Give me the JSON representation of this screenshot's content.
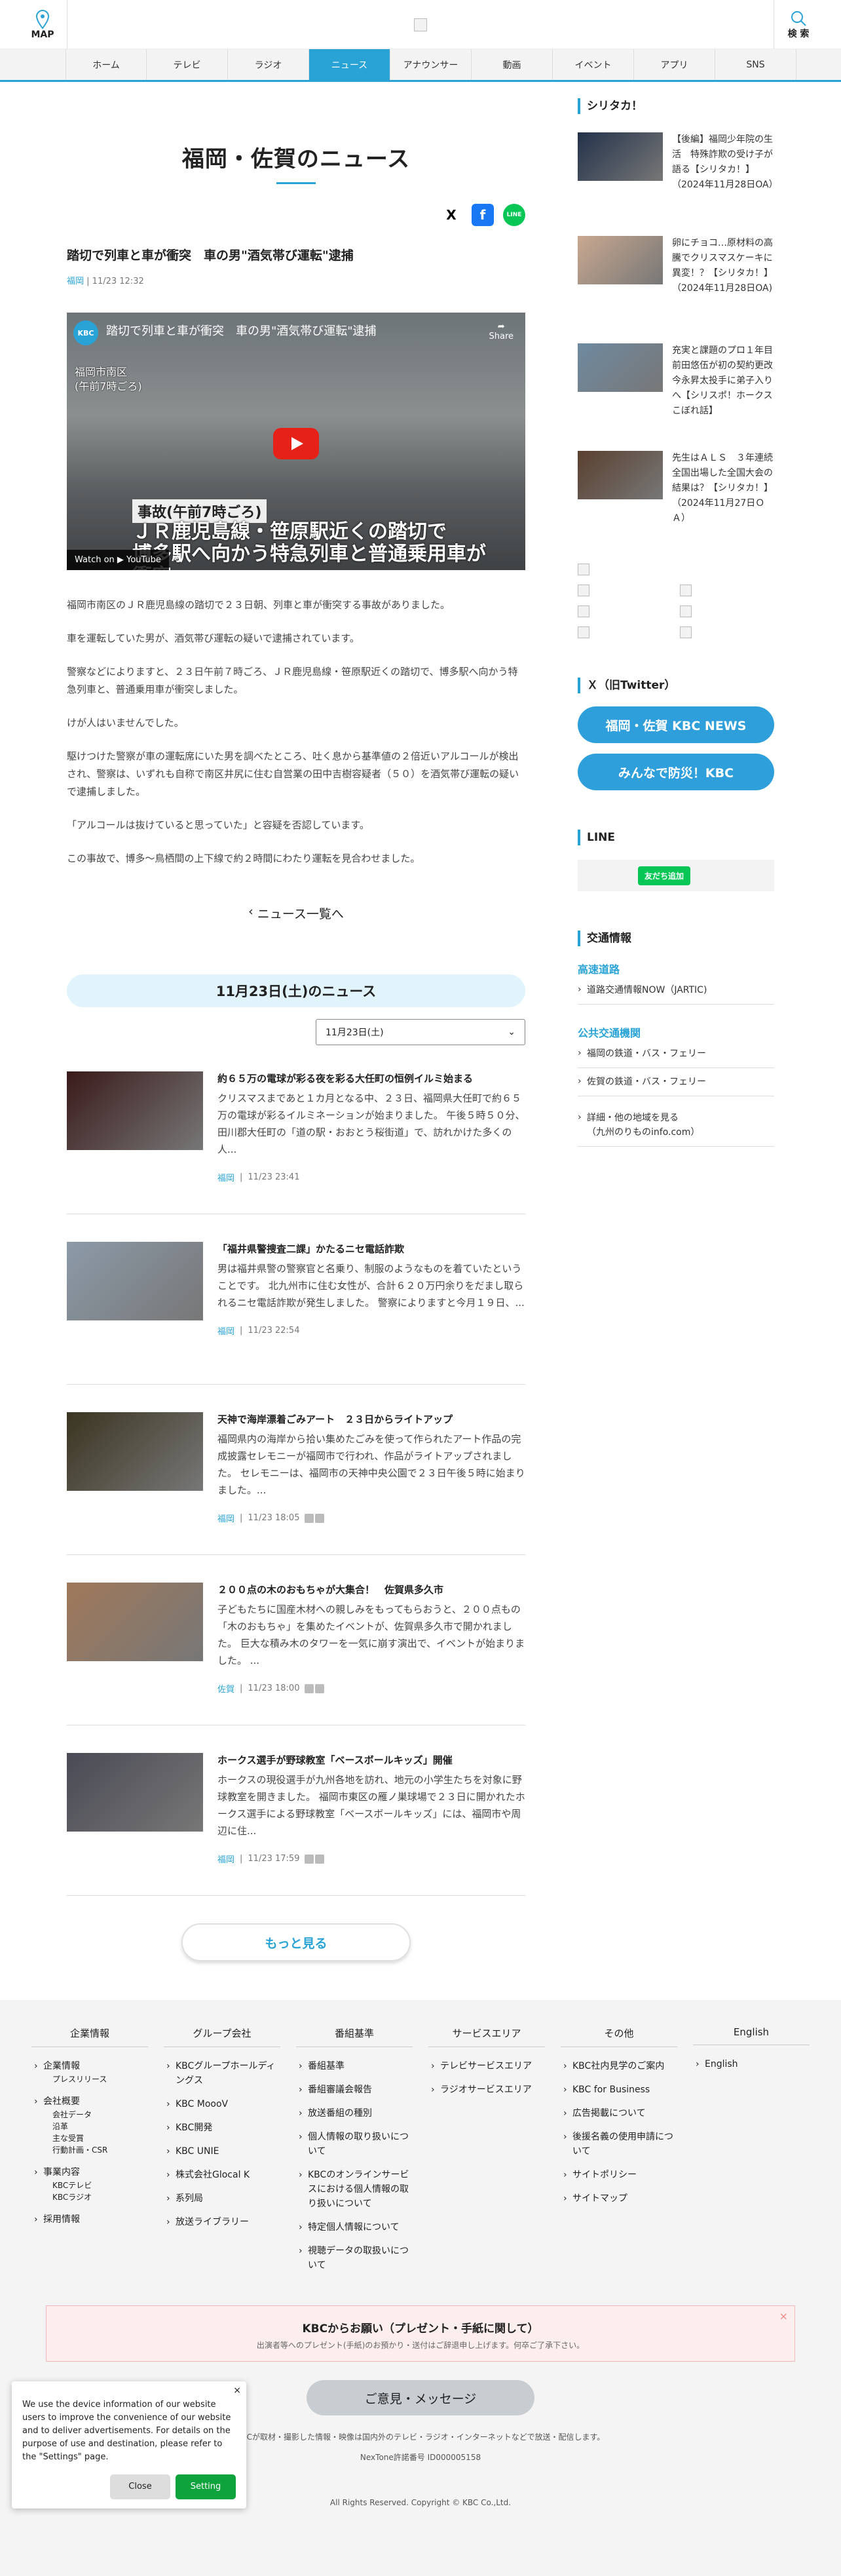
{
  "header": {
    "map_label": "MAP",
    "search_label": "検 索"
  },
  "nav": [
    "ホーム",
    "テレビ",
    "ラジオ",
    "ニュース",
    "アナウンサー",
    "動画",
    "イベント",
    "アプリ",
    "SNS"
  ],
  "section_title": "福岡・佐賀のニュース",
  "share": {
    "x": "X",
    "facebook": "f",
    "line": "LINE"
  },
  "article": {
    "title": "踏切で列車と車が衝突　車の男\"酒気帯び運転\"逮捕",
    "category": "福岡",
    "datetime": "11/23 12:32",
    "video": {
      "channel": "KBC",
      "title": "踏切で列車と車が衝突　車の男\"酒気帯び運転\"逮捕",
      "share": "Share",
      "side_caption": "福岡市南区\n(午前7時ごろ)",
      "caption1": "事故(午前7時ごろ)",
      "caption2": "ＪＲ鹿児島線・笹原駅近くの踏切で\n博多駅へ向かう特急列車と普通乗用車が衝突",
      "watch_on": "Watch on ▶ YouTube"
    },
    "paragraphs": [
      "福岡市南区のＪＲ鹿児島線の踏切で２３日朝、列車と車が衝突する事故がありました。",
      "車を運転していた男が、酒気帯び運転の疑いで逮捕されています。",
      "警察などによりますと、２３日午前７時ごろ、ＪＲ鹿児島線・笹原駅近くの踏切で、博多駅へ向かう特急列車と、普通乗用車が衝突しました。",
      "けが人はいませんでした。",
      "駆けつけた警察が車の運転席にいた男を調べたところ、吐く息から基準値の２倍近いアルコールが検出され、警察は、いずれも自称で南区井尻に住む自営業の田中吉樹容疑者（５０）を酒気帯び運転の疑いで逮捕しました。",
      "「アルコールは抜けていると思っていた」と容疑を否認しています。",
      "この事故で、博多～鳥栖間の上下線で約２時間にわたり運転を見合わせました。"
    ]
  },
  "back_link": "ニュース一覧へ",
  "date_band": "11月23日(土)のニュース",
  "date_select": "11月23日(土)",
  "news_list": [
    {
      "title": "約６５万の電球が彩る夜を彩る大任町の恒例イルミ始まる",
      "desc": "クリスマスまであと１カ月となる中、２３日、福岡県大任町で約６５万の電球が彩るイルミネーションが始まりました。 午後５時５０分、田川郡大任町の「道の駅・おおとう桜街道」で、訪れかけた多くの人...",
      "category": "福岡",
      "datetime": "11/23 23:41",
      "badge": false,
      "thumb": "#3a1a1a"
    },
    {
      "title": "「福井県警捜査二課」かたるニセ電話詐欺",
      "desc": "男は福井県警の警察官と名乗り、制服のようなものを着ていたということです。 北九州市に住む女性が、合計６２０万円余りをだまし取られるニセ電話詐欺が発生しました。 警察によりますと今月１９日、...",
      "category": "福岡",
      "datetime": "11/23 22:54",
      "badge": false,
      "thumb": "#8c9aa8"
    },
    {
      "title": "天神で海岸漂着ごみアート　２３日からライトアップ",
      "desc": "福岡県内の海岸から拾い集めたごみを使って作られたアート作品の完成披露セレモニーが福岡市で行われ、作品がライトアップされました。 セレモニーは、福岡市の天神中央公園で２３日午後５時に始まりました。...",
      "category": "福岡",
      "datetime": "11/23 18:05",
      "badge": true,
      "thumb": "#3a3420"
    },
    {
      "title": "２００点の木のおもちゃが大集合！　佐賀県多久市",
      "desc": "子どもたちに国産木材への親しみをもってもらおうと、２００点もの「木のおもちゃ」を集めたイベントが、佐賀県多久市で開かれました。 巨大な積み木のタワーを一気に崩す演出で、イベントが始まりました。 ...",
      "category": "佐賀",
      "datetime": "11/23 18:00",
      "badge": true,
      "thumb": "#a0785a"
    },
    {
      "title": "ホークス選手が野球教室「ベースボールキッズ」開催",
      "desc": "ホークスの現役選手が九州各地を訪れ、地元の小学生たちを対象に野球教室を開きました。 福岡市東区の雁ノ巣球場で２３日に開かれたホークス選手による野球教室「ベースボールキッズ」には、福岡市や周辺に住...",
      "category": "福岡",
      "datetime": "11/23 17:59",
      "badge": true,
      "thumb": "#4a4a55"
    }
  ],
  "more_button": "もっと見る",
  "sidebar": {
    "shiritaka_title": "シリタカ！",
    "shiritaka": [
      {
        "text": "【後編】福岡少年院の生活　特殊詐欺の受け子が語る【シリタカ！】（2024年11月28日OA）",
        "thumb": "#23324a"
      },
      {
        "text": "卵にチョコ…原材料の高騰でクリスマスケーキに異変！？【シリタカ！】（2024年11月28日OA)",
        "thumb": "#c9a890"
      },
      {
        "text": "充実と課題のプロ１年目 前田悠伍が初の契約更改 今永昇太投手に弟子入りへ【シリスポ！ホークスこぼれ話】",
        "thumb": "#6f8aa0"
      },
      {
        "text": "先生はＡＬＳ　３年連続全国出場した全国大会の結果は？【シリタカ！】（2024年11月27日ＯＡ）",
        "thumb": "#5a4030"
      }
    ],
    "x_title": "Ｘ（旧Twitter）",
    "x_buttons": [
      "福岡・佐賀 KBC NEWS",
      "みんなで防災！KBC"
    ],
    "line_title": "LINE",
    "line_button": "友だち追加",
    "traffic_title": "交通情報",
    "road_label": "高速道路",
    "road_links": [
      "道路交通情報NOW（JARTIC)"
    ],
    "public_label": "公共交通機関",
    "public_links": [
      "福岡の鉄道・バス・フェリー",
      "佐賀の鉄道・バス・フェリー",
      "詳細・他の地域を見る\n（九州のりものinfo.com）"
    ]
  },
  "footer": {
    "columns": [
      {
        "title": "企業情報",
        "items": [
          {
            "label": "企業情報",
            "subs": [
              "プレスリリース"
            ]
          },
          {
            "label": "会社概要",
            "subs": [
              "会社データ",
              "沿革",
              "主な受賞",
              "行動計画・CSR"
            ]
          },
          {
            "label": "事業内容",
            "subs": [
              "KBCテレビ",
              "KBCラジオ"
            ]
          },
          {
            "label": "採用情報",
            "subs": []
          }
        ]
      },
      {
        "title": "グループ会社",
        "items": [
          {
            "label": "KBCグループホールディングス",
            "subs": []
          },
          {
            "label": "KBC MoooV",
            "subs": []
          },
          {
            "label": "KBC開発",
            "subs": []
          },
          {
            "label": "KBC UNIE",
            "subs": []
          },
          {
            "label": "株式会社Glocal K",
            "subs": []
          },
          {
            "label": "系列局",
            "subs": []
          },
          {
            "label": "放送ライブラリー",
            "subs": []
          }
        ]
      },
      {
        "title": "番組基準",
        "items": [
          {
            "label": "番組基準",
            "subs": []
          },
          {
            "label": "番組審議会報告",
            "subs": []
          },
          {
            "label": "放送番組の種別",
            "subs": []
          },
          {
            "label": "個人情報の取り扱いについて",
            "subs": []
          },
          {
            "label": "KBCのオンラインサービスにおける個人情報の取り扱いについて",
            "subs": []
          },
          {
            "label": "特定個人情報について",
            "subs": []
          },
          {
            "label": "視聴データの取扱いについて",
            "subs": []
          }
        ]
      },
      {
        "title": "サービスエリア",
        "items": [
          {
            "label": "テレビサービスエリア",
            "subs": []
          },
          {
            "label": "ラジオサービスエリア",
            "subs": []
          }
        ]
      },
      {
        "title": "その他",
        "items": [
          {
            "label": "KBC社内見学のご案内",
            "subs": []
          },
          {
            "label": "KBC for Business",
            "subs": []
          },
          {
            "label": "広告掲載について",
            "subs": []
          },
          {
            "label": "後援名義の使用申請について",
            "subs": []
          },
          {
            "label": "サイトポリシー",
            "subs": []
          },
          {
            "label": "サイトマップ",
            "subs": []
          }
        ]
      },
      {
        "title": "English",
        "items": [
          {
            "label": "English",
            "subs": []
          }
        ]
      }
    ],
    "gift_title": "KBCからお願い（プレゼント・手紙に関して）",
    "gift_text": "出演者等へのプレゼント(手紙)のお預かり・送付はご辞退申し上げます。何卒ご了承下さい。",
    "opinion": "ご意見・メッセージ",
    "note": "KBCが取材・撮影した情報・映像は国内外のテレビ・ラジオ・インターネットなどで放送・配信します。",
    "nextone": "NexTone許諾番号 ID000005158",
    "copyright": "All Rights Reserved. Copyright © KBC Co.,Ltd."
  },
  "cookie": {
    "text": "We use the device information of our website users to improve the convenience of our website and to deliver advertisements. For details on the purpose of use and destination, please refer to the \"Settings\" page.",
    "close": "Close",
    "setting": "Setting",
    "x": "×"
  },
  "colors": {
    "accent": "#29a3d6",
    "x_button": "#2f9fdc",
    "line_green": "#06c755",
    "setting_green": "#0ea33c"
  }
}
